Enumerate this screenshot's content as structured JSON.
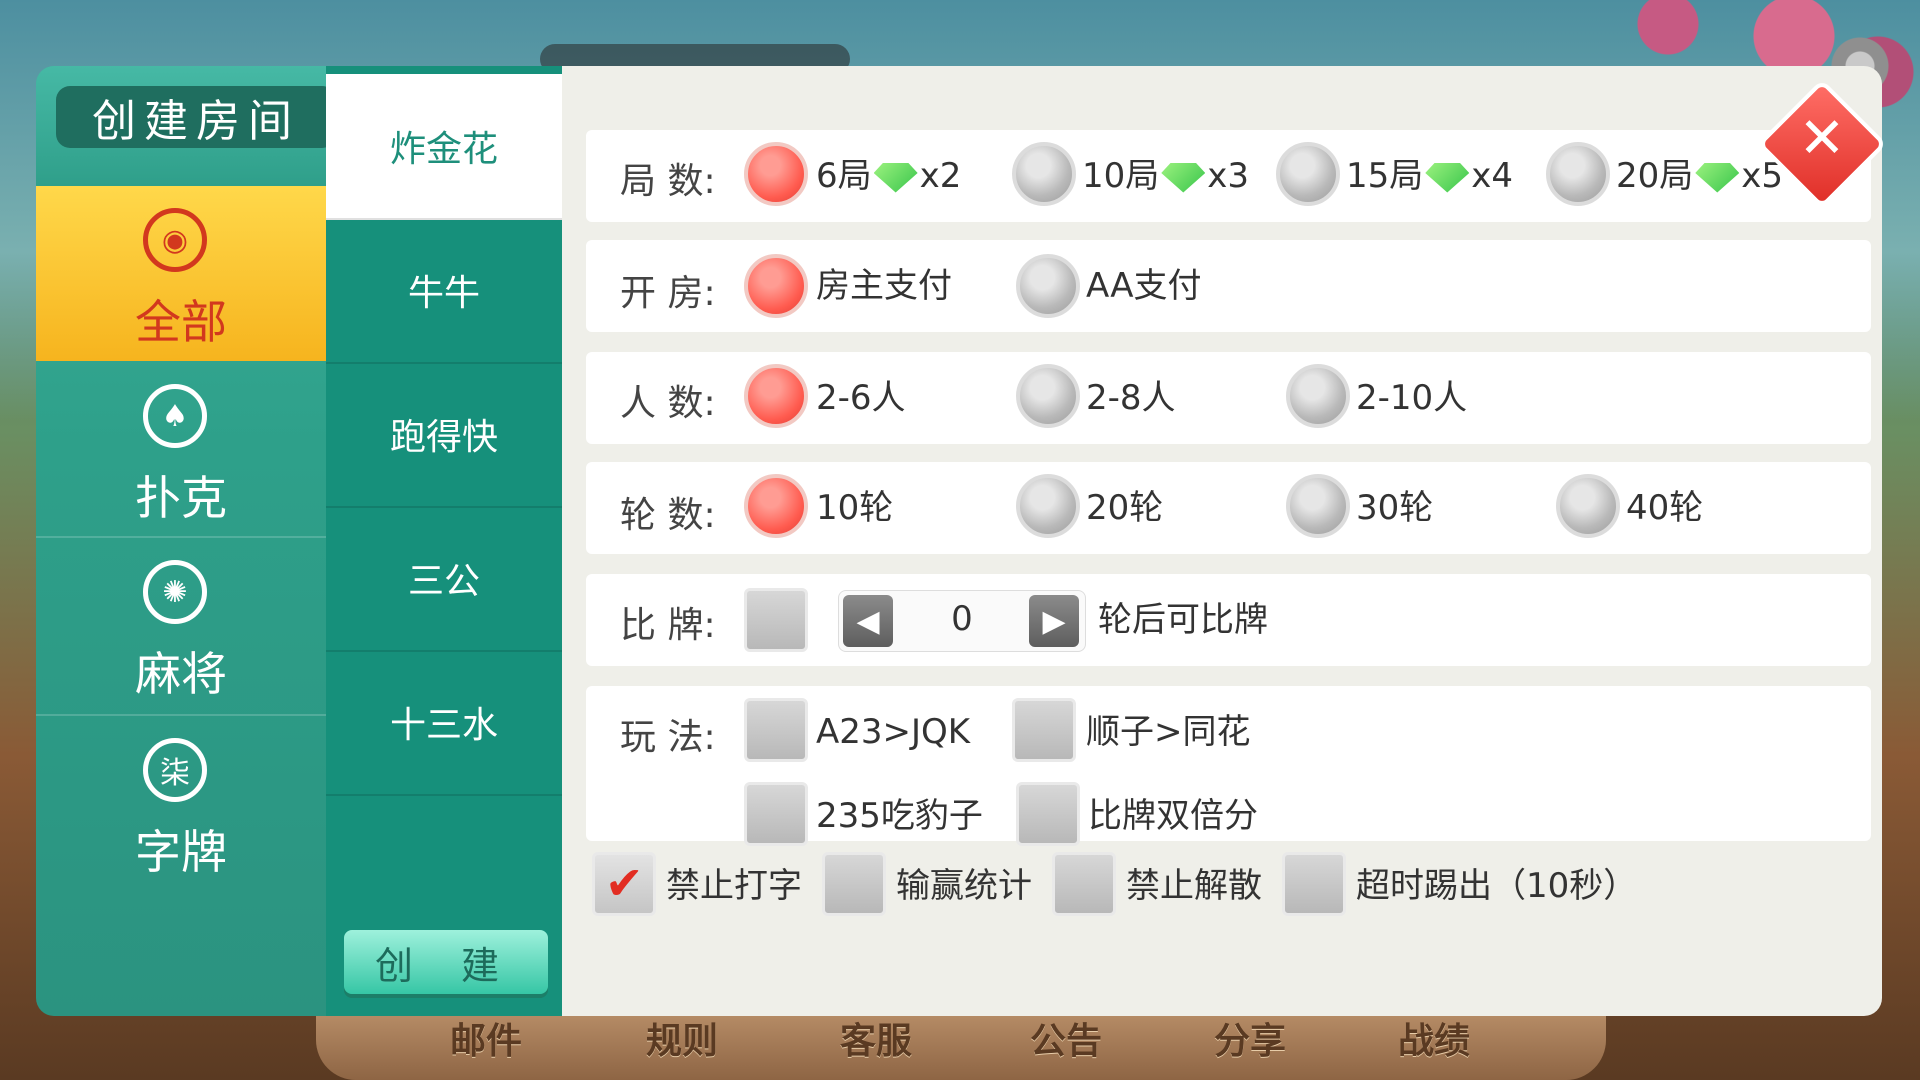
{
  "header": {
    "title": "创建房间"
  },
  "categories": [
    {
      "label": "全部",
      "icon": "gamepad-icon"
    },
    {
      "label": "扑克",
      "icon": "spade-icon"
    },
    {
      "label": "麻将",
      "icon": "mahjong-icon"
    },
    {
      "label": "字牌",
      "icon": "zipai-icon"
    }
  ],
  "games": [
    "炸金花",
    "牛牛",
    "跑得快",
    "三公",
    "十三水"
  ],
  "create_button": "创 建",
  "rows": {
    "rounds": {
      "label": "局 数:",
      "options": [
        {
          "text": "6局",
          "mult": "x2"
        },
        {
          "text": "10局",
          "mult": "x3"
        },
        {
          "text": "15局",
          "mult": "x4"
        },
        {
          "text": "20局",
          "mult": "x5"
        }
      ]
    },
    "payment": {
      "label": "开 房:",
      "options": [
        "房主支付",
        "AA支付"
      ]
    },
    "players": {
      "label": "人 数:",
      "options": [
        "2-6人",
        "2-8人",
        "2-10人"
      ]
    },
    "turns": {
      "label": "轮 数:",
      "options": [
        "10轮",
        "20轮",
        "30轮",
        "40轮"
      ]
    },
    "compare": {
      "label": "比 牌:",
      "value": "0",
      "suffix": "轮后可比牌"
    },
    "play": {
      "label": "玩 法:",
      "options": [
        "A23>JQK",
        "顺子>同花",
        "235吃豹子",
        "比牌双倍分"
      ]
    }
  },
  "extras": [
    "禁止打字",
    "输赢统计",
    "禁止解散",
    "超时踢出（10秒）"
  ],
  "bottom_tabs": [
    "邮件",
    "规则",
    "客服",
    "公告",
    "分享",
    "战绩"
  ],
  "colors": {
    "accent_teal": "#16907b",
    "selected_red": "#ff5b4f",
    "gold": "#f6b41e"
  }
}
